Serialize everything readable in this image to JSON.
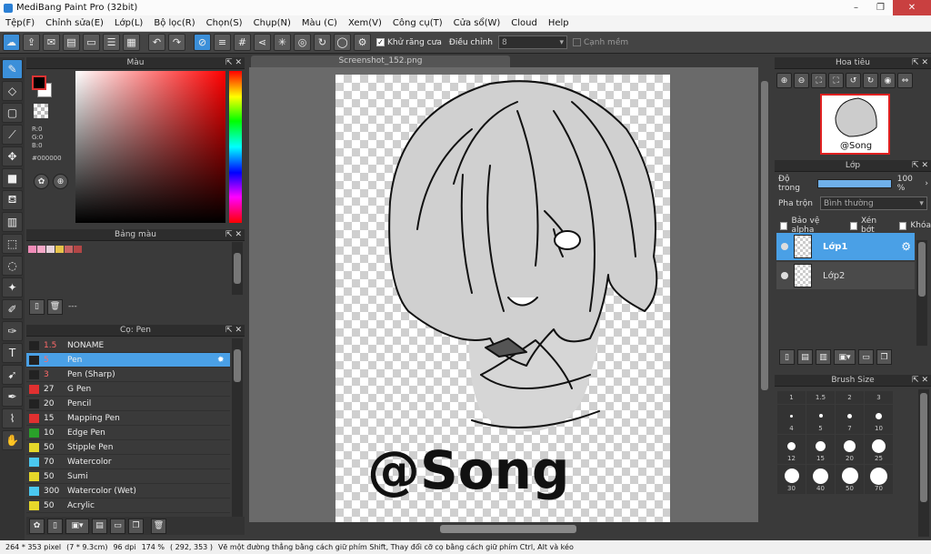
{
  "window": {
    "title": "MediBang Paint Pro (32bit)"
  },
  "menu": [
    "Tệp(F)",
    "Chỉnh sửa(E)",
    "Lớp(L)",
    "Bộ lọc(R)",
    "Chọn(S)",
    "Chụp(N)",
    "Màu (C)",
    "Xem(V)",
    "Công cụ(T)",
    "Cửa sổ(W)",
    "Cloud",
    "Help"
  ],
  "toolbar": {
    "antialias_label": "Khử răng cưa",
    "correction_label": "Điều chỉnh",
    "correction_value": "8",
    "soft_edge_label": "Cạnh mềm",
    "antialias_check": "✓"
  },
  "color_panel": {
    "title": "Màu",
    "r": "R:0",
    "g": "G:0",
    "b": "B:0",
    "hex": "#000000"
  },
  "palette_panel": {
    "title": "Bảng màu",
    "empty": "---",
    "swatches": [
      "#f08cb8",
      "#f6a8c8",
      "#e6d2dc",
      "#e6c24a",
      "#c86464",
      "#b24646"
    ]
  },
  "brush_panel": {
    "title": "Cọ: Pen",
    "brushes": [
      {
        "size": "1.5",
        "name": "NONAME",
        "color": "#222222",
        "red": true
      },
      {
        "size": "5",
        "name": "Pen",
        "color": "#222222",
        "red": true,
        "selected": true
      },
      {
        "size": "3",
        "name": "Pen (Sharp)",
        "color": "#222222",
        "red": true
      },
      {
        "size": "27",
        "name": "G Pen",
        "color": "#e03030",
        "red": false
      },
      {
        "size": "20",
        "name": "Pencil",
        "color": "#222222",
        "red": false
      },
      {
        "size": "15",
        "name": "Mapping Pen",
        "color": "#e03030",
        "red": false
      },
      {
        "size": "10",
        "name": "Edge Pen",
        "color": "#2aa02a",
        "red": false
      },
      {
        "size": "50",
        "name": "Stipple Pen",
        "color": "#e6d82a",
        "red": false
      },
      {
        "size": "70",
        "name": "Watercolor",
        "color": "#4ac8f0",
        "red": false
      },
      {
        "size": "50",
        "name": "Sumi",
        "color": "#e6d82a",
        "red": false
      },
      {
        "size": "300",
        "name": "Watercolor (Wet)",
        "color": "#4ac8f0",
        "red": false
      },
      {
        "size": "50",
        "name": "Acrylic",
        "color": "#e6d82a",
        "red": false
      }
    ]
  },
  "canvas": {
    "tab": "Screenshot_152.png",
    "signature": "@Song"
  },
  "navigator": {
    "title": "Hoa tiêu"
  },
  "layer_panel": {
    "title": "Lớp",
    "opacity_label": "Độ trong",
    "opacity_value": "100 %",
    "opacity": 1.0,
    "blend_label": "Pha trộn",
    "blend_value": "Bình thường",
    "protect_alpha": "Bảo vệ alpha",
    "clipping": "Xén bớt",
    "lock": "Khóa",
    "layers": [
      {
        "name": "Lớp1",
        "selected": true
      },
      {
        "name": "Lớp2",
        "selected": false
      }
    ]
  },
  "brush_size_panel": {
    "title": "Brush Size",
    "sizes": [
      "1",
      "1.5",
      "2",
      "3",
      "4",
      "5",
      "7",
      "10",
      "12",
      "15",
      "20",
      "25",
      "30",
      "40",
      "50",
      "70"
    ]
  },
  "status": {
    "size": "264 * 353 pixel",
    "cm": "(7 * 9.3cm)",
    "dpi": "96 dpi",
    "zoom": "174 %",
    "coords": "( 292, 353 )",
    "hint": "Vẽ một đường thẳng bằng cách giữ phím Shift, Thay đổi cỡ cọ bằng cách giữ phím Ctrl, Alt và kéo"
  }
}
